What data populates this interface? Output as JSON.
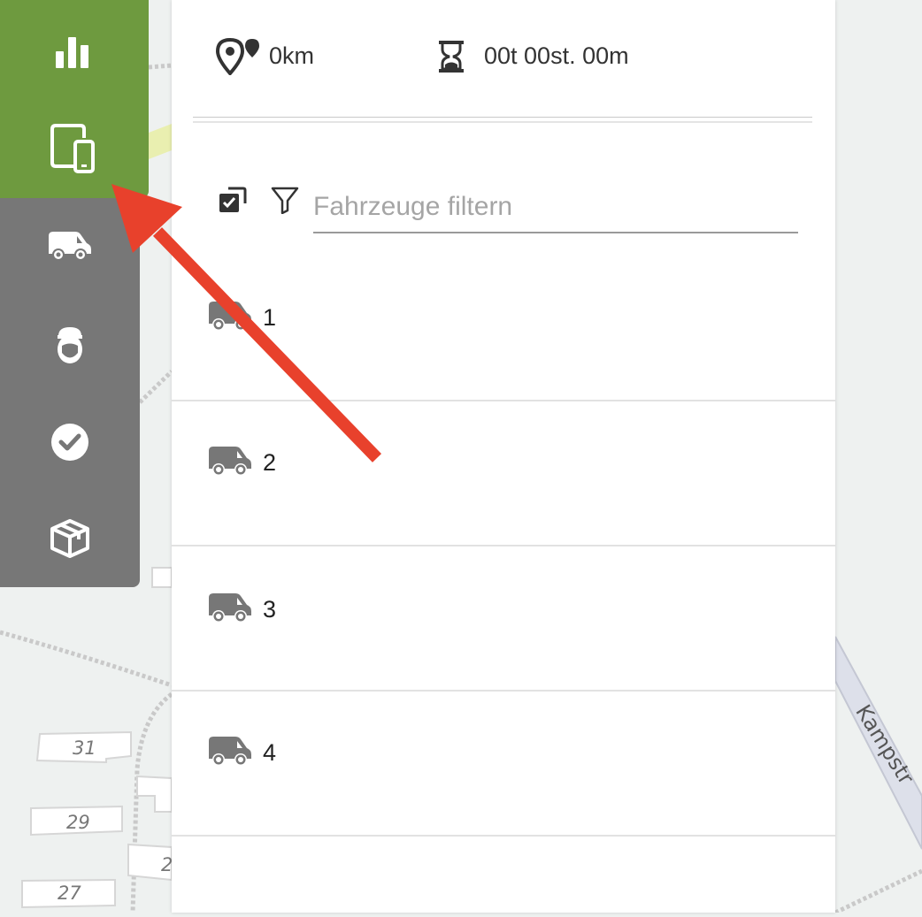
{
  "sidebar": {
    "items": [
      {
        "icon": "bar-chart-icon"
      },
      {
        "icon": "devices-icon",
        "active": true
      },
      {
        "icon": "van-icon"
      },
      {
        "icon": "driver-icon"
      },
      {
        "icon": "check-circle-icon"
      },
      {
        "icon": "package-icon"
      }
    ],
    "active_color": "#6e9a3f",
    "inactive_color": "#777777"
  },
  "stats": {
    "distance": "0km",
    "duration": "00t 00st. 00m"
  },
  "filter": {
    "placeholder": "Fahrzeuge filtern",
    "value": ""
  },
  "vehicles": [
    {
      "label": "1"
    },
    {
      "label": "2"
    },
    {
      "label": "3"
    },
    {
      "label": "4"
    }
  ],
  "map": {
    "house_numbers": [
      "31",
      "29",
      "27",
      "2"
    ],
    "street": "Kampstr"
  },
  "annotation": {
    "arrow_color": "#e8412c"
  }
}
